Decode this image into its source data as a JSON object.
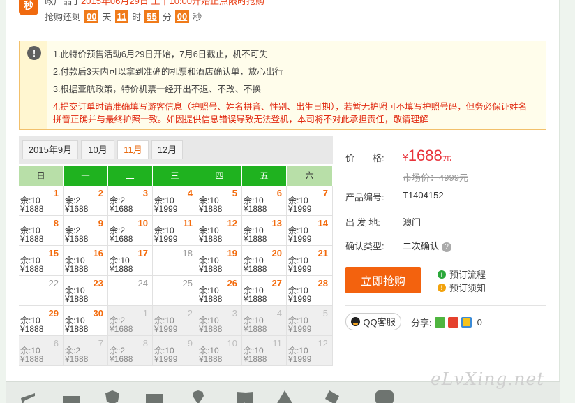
{
  "countdown": {
    "badge": "秒",
    "top_text_pre": "政广品了",
    "top_text_highlight": "2015年06月29日 上午10:00",
    "top_text_post": "开始正点限时抢购",
    "label": "抢购还剩",
    "days": "00",
    "days_unit": "天",
    "hours": "11",
    "hours_unit": "时",
    "minutes": "55",
    "minutes_unit": "分",
    "seconds": "00",
    "seconds_unit": "秒"
  },
  "notice": {
    "icon": "exclamation-icon",
    "lines": [
      "1.此特价预售活动6月29日开始，7月6日截止，机不可失",
      "2.付款后3天内可以拿到准确的机票和酒店确认单，放心出行",
      "3.根据亚航政策，特价机票一经开出不退、不改、不换",
      "4.提交订单时请准确填写游客信息（护照号、姓名拼音、性别、出生日期），若暂无护照可不填写护照号码，但务必保证姓名",
      "拼音正确并与最终护照一致。如因提供信息错误导致无法登机，本司将不对此承担责任，敬请理解"
    ]
  },
  "calendar": {
    "tabs": [
      "2015年9月",
      "10月",
      "11月",
      "12月"
    ],
    "active_tab": 2,
    "weekdays": [
      "日",
      "一",
      "二",
      "三",
      "四",
      "五",
      "六"
    ],
    "days": [
      {
        "d": "1",
        "s": "余:10",
        "p": "¥1888"
      },
      {
        "d": "2",
        "s": "余:2",
        "p": "¥1688"
      },
      {
        "d": "3",
        "s": "余:2",
        "p": "¥1688"
      },
      {
        "d": "4",
        "s": "余:10",
        "p": "¥1999"
      },
      {
        "d": "5",
        "s": "余:10",
        "p": "¥1888"
      },
      {
        "d": "6",
        "s": "余:10",
        "p": "¥1888"
      },
      {
        "d": "7",
        "s": "余:10",
        "p": "¥1999"
      },
      {
        "d": "8",
        "s": "余:10",
        "p": "¥1888"
      },
      {
        "d": "9",
        "s": "余:2",
        "p": "¥1688"
      },
      {
        "d": "10",
        "s": "余:2",
        "p": "¥1688"
      },
      {
        "d": "11",
        "s": "余:10",
        "p": "¥1999"
      },
      {
        "d": "12",
        "s": "余:10",
        "p": "¥1888"
      },
      {
        "d": "13",
        "s": "余:10",
        "p": "¥1888"
      },
      {
        "d": "14",
        "s": "余:10",
        "p": "¥1999"
      },
      {
        "d": "15",
        "s": "余:10",
        "p": "¥1888"
      },
      {
        "d": "16",
        "s": "余:10",
        "p": "¥1888"
      },
      {
        "d": "17",
        "s": "余:10",
        "p": "¥1888"
      },
      {
        "d": "18",
        "s": "",
        "p": ""
      },
      {
        "d": "19",
        "s": "余:10",
        "p": "¥1888"
      },
      {
        "d": "20",
        "s": "余:10",
        "p": "¥1888"
      },
      {
        "d": "21",
        "s": "余:10",
        "p": "¥1999"
      },
      {
        "d": "22",
        "s": "",
        "p": ""
      },
      {
        "d": "23",
        "s": "余:10",
        "p": "¥1888"
      },
      {
        "d": "24",
        "s": "",
        "p": ""
      },
      {
        "d": "25",
        "s": "",
        "p": ""
      },
      {
        "d": "26",
        "s": "余:10",
        "p": "¥1888"
      },
      {
        "d": "27",
        "s": "余:10",
        "p": "¥1888"
      },
      {
        "d": "28",
        "s": "余:10",
        "p": "¥1999"
      },
      {
        "d": "29",
        "s": "余:10",
        "p": "¥1888"
      },
      {
        "d": "30",
        "s": "余:10",
        "p": "¥1888"
      },
      {
        "d": "1",
        "s": "余:2",
        "p": "¥1688"
      },
      {
        "d": "2",
        "s": "余:10",
        "p": "¥1999"
      },
      {
        "d": "3",
        "s": "余:10",
        "p": "¥1888"
      },
      {
        "d": "4",
        "s": "余:10",
        "p": "¥1888"
      },
      {
        "d": "5",
        "s": "余:10",
        "p": "¥1999"
      },
      {
        "d": "6",
        "s": "余:10",
        "p": "¥1888"
      },
      {
        "d": "7",
        "s": "余:2",
        "p": "¥1688"
      },
      {
        "d": "8",
        "s": "余:2",
        "p": "¥1688"
      },
      {
        "d": "9",
        "s": "余:10",
        "p": "¥1999"
      },
      {
        "d": "10",
        "s": "余:10",
        "p": "¥1888"
      },
      {
        "d": "11",
        "s": "余:10",
        "p": "¥1888"
      },
      {
        "d": "12",
        "s": "余:10",
        "p": "¥1999"
      }
    ]
  },
  "product": {
    "price_label": "价　　格:",
    "price_currency": "¥",
    "price": "1688",
    "price_unit": "元",
    "market_price": "市场价：4999元",
    "code_label": "产品编号:",
    "code": "T1404152",
    "departure_label": "出 发 地:",
    "departure": "澳门",
    "confirm_label": "确认类型:",
    "confirm": "二次确认",
    "buy_button": "立即抢购",
    "flow_link": "预订流程",
    "notice_link": "预订须知",
    "qq_button": "QQ客服",
    "share_label": "分享:",
    "share_count": "0"
  },
  "watermark": "eLvXing.net",
  "colors": {
    "accent": "#f3620e",
    "green": "#1fb21f",
    "price": "#e8333b"
  }
}
